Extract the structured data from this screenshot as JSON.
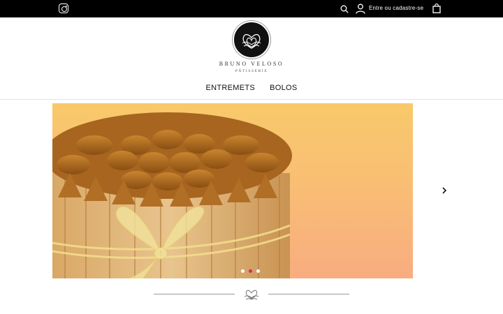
{
  "topbar": {
    "login_label": "Entre ou cadastre-se",
    "icons": [
      "instagram-icon",
      "search-icon",
      "user-icon",
      "shopping-bag-icon"
    ]
  },
  "brand": {
    "name": "BRUNO VELOSO",
    "subtitle": "PÂTISSERIE"
  },
  "nav": {
    "items": [
      {
        "label": "ENTREMETS"
      },
      {
        "label": "BOLOS"
      }
    ]
  },
  "carousel": {
    "slide_count": 3,
    "active_index": 1,
    "next_icon": "chevron-right-icon"
  },
  "colors": {
    "topbar": "#000000",
    "active_dot": "#d5286a",
    "banner_top": "#f8c96a",
    "banner_bottom": "#f8ac80"
  }
}
